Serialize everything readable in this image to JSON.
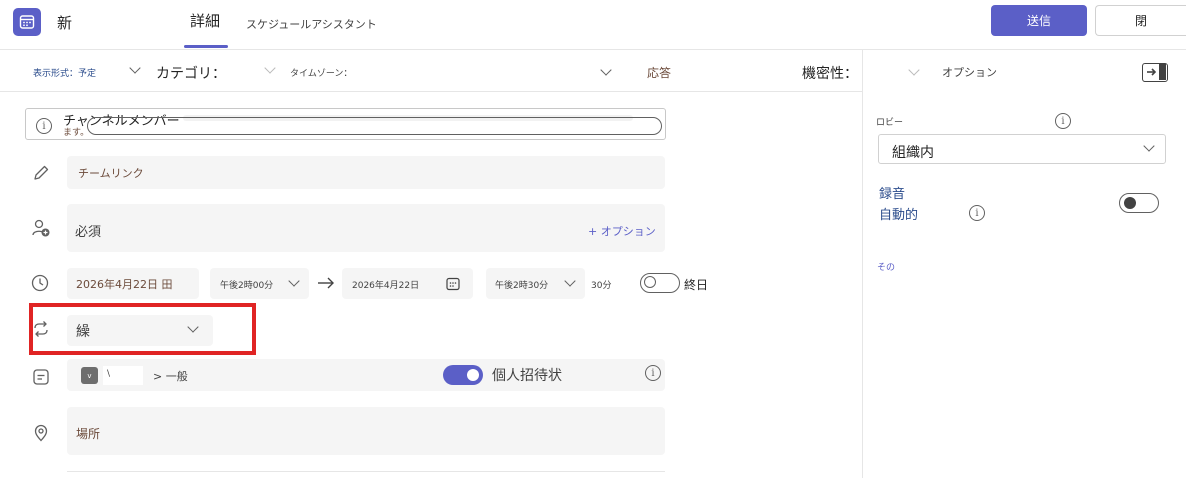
{
  "header": {
    "app_title": "新",
    "tab_details": "詳細",
    "tab_assistant": "スケジュールアシスタント",
    "send_label": "送信",
    "close_label": "閉"
  },
  "options": {
    "display_format": "表示形式：予定",
    "category": "カテゴリ：",
    "timezone": "タイムゾーン：",
    "response": "応答",
    "sensitivity": "機密性：",
    "options_label": "オプション"
  },
  "form": {
    "channel_notice_line1": "チャンネルメンバー",
    "channel_notice_line2": "ます。",
    "title_placeholder": "チームリンク",
    "attendees_placeholder": "必須",
    "attendees_option": "+ オプション",
    "start_date": "2026年4月22日 田",
    "start_time": "午後2時00分",
    "end_date": "2026年4月22日",
    "end_time": "午後2時30分",
    "duration": "30分",
    "all_day_label": "終日",
    "repeat_value": "繰",
    "channel_badge": "v",
    "channel_char": "\\",
    "channel_path": "> 一般",
    "personal_invite_label": "個人招待状",
    "location_placeholder": "場所"
  },
  "panel": {
    "lobby_label": "ロビー",
    "lobby_value": "組織内",
    "record_label_line1": "録音",
    "record_label_line2": "自動的",
    "other_label": "その"
  },
  "colors": {
    "accent": "#5b5fc7",
    "highlight": "#e02424"
  }
}
